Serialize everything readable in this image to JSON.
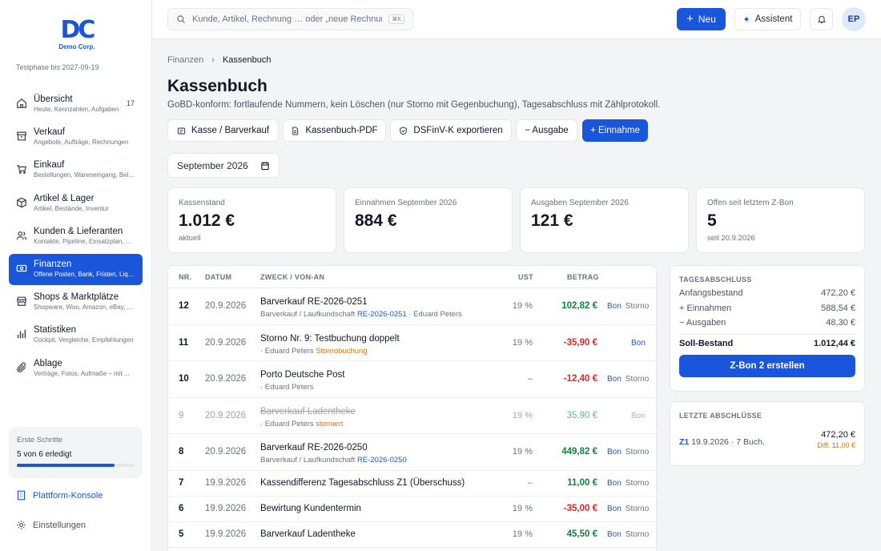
{
  "brand": {
    "logo_mark": "DC",
    "logo_text": "Demo Corp.",
    "trial": "Testphase bis 2027-09-19"
  },
  "nav": [
    {
      "title": "Übersicht",
      "sub": "Heute, Kennzahlen, Aufgaben",
      "count": "17",
      "icon": "home-icon"
    },
    {
      "title": "Verkauf",
      "sub": "Angebote, Aufträge, Rechnungen",
      "icon": "archive-box-icon"
    },
    {
      "title": "Einkauf",
      "sub": "Bestellungen, Wareneingang, Belege",
      "icon": "cart-icon"
    },
    {
      "title": "Artikel & Lager",
      "sub": "Artikel, Bestände, Inventur",
      "icon": "cube-icon"
    },
    {
      "title": "Kunden & Lieferanten",
      "sub": "Kontakte, Pipeline, Einsatzplan, ...",
      "icon": "users-icon"
    },
    {
      "title": "Finanzen",
      "sub": "Offene Posten, Bank, Fristen, Liquidität",
      "icon": "banknote-icon",
      "active": true
    },
    {
      "title": "Shops & Marktplätze",
      "sub": "Shopware, Woo, Amazon, eBay, ...",
      "icon": "shop-icon"
    },
    {
      "title": "Statistiken",
      "sub": "Cockpit, Vergleiche, Empfehlungen",
      "icon": "bar-chart-icon"
    },
    {
      "title": "Ablage",
      "sub": "Verträge, Fotos, Aufmaße – mit ...",
      "icon": "paperclip-icon"
    }
  ],
  "onboarding": {
    "label": "Erste Schritte",
    "value": "5 von 6 erledigt",
    "progress": 0.833
  },
  "footer": {
    "platform": "Plattform-Konsole",
    "settings": "Einstellungen"
  },
  "topbar": {
    "search_placeholder": "Kunde, Artikel, Rechnung … oder „neue Rechnung“",
    "shortcut": "⌘K",
    "new_label": "Neu",
    "assistant_label": "Assistent",
    "avatar": "EP"
  },
  "breadcrumb": {
    "parent": "Finanzen",
    "separator": "›",
    "current": "Kassenbuch"
  },
  "page": {
    "title": "Kassenbuch",
    "subtitle": "GoBD-konform: fortlaufende Nummern, kein Löschen (nur Storno mit Gegenbuchung), Tagesabschluss mit Zählprotokoll."
  },
  "actions": {
    "kasse": "Kasse / Barverkauf",
    "pdf": "Kassenbuch-PDF",
    "dsfinvk": "DSFinV-K exportieren",
    "ausgabe": "− Ausgabe",
    "einnahme": "+ Einnahme"
  },
  "period": "September 2026",
  "kpis": [
    {
      "label": "Kassenstand",
      "value": "1.012 €",
      "sub": "aktuell"
    },
    {
      "label": "Einnahmen September 2026",
      "value": "884 €",
      "sub": ""
    },
    {
      "label": "Ausgaben September 2026",
      "value": "121 €",
      "sub": ""
    },
    {
      "label": "Offen seit letztem Z-Bon",
      "value": "5",
      "sub": "seit 20.9.2026"
    }
  ],
  "table": {
    "headers": {
      "nr": "NR.",
      "datum": "DATUM",
      "zweck": "ZWECK / VON-AN",
      "ust": "UST",
      "betrag": "BETRAG"
    },
    "bon": "Bon",
    "storno": "Storno",
    "rows": [
      {
        "nr": "12",
        "datum": "20.9.2026",
        "zweck": "Barverkauf RE-2026-0251",
        "sub_a": "Barverkauf / Laufkundschaft",
        "sub_link": "RE-2026-0251",
        "sub_b": "· Eduard Peters",
        "sub_tag": "",
        "ust": "19 %",
        "betrag": "102,82 €",
        "sign": "pos",
        "storno": true
      },
      {
        "nr": "11",
        "datum": "20.9.2026",
        "zweck": "Storno Nr. 9: Testbuchung doppelt",
        "sub_a": "",
        "sub_link": "",
        "sub_b": "· Eduard Peters",
        "sub_tag": "Stornobuchung",
        "ust": "19 %",
        "betrag": "-35,90 €",
        "sign": "neg",
        "storno": false
      },
      {
        "nr": "10",
        "datum": "20.9.2026",
        "zweck": "Porto Deutsche Post",
        "sub_a": "",
        "sub_link": "",
        "sub_b": "· Eduard Peters",
        "sub_tag": "",
        "ust": "–",
        "betrag": "-12,40 €",
        "sign": "neg",
        "storno": true
      },
      {
        "nr": "9",
        "datum": "20.9.2026",
        "zweck": "Barverkauf Ladentheke",
        "sub_a": "",
        "sub_link": "",
        "sub_b": "· Eduard Peters",
        "sub_tag": "storniert",
        "ust": "19 %",
        "betrag": "35,90 €",
        "sign": "pos",
        "storno": false,
        "muted": true
      },
      {
        "nr": "8",
        "datum": "20.9.2026",
        "zweck": "Barverkauf RE-2026-0250",
        "sub_a": "Barverkauf / Laufkundschaft",
        "sub_link": "RE-2026-0250",
        "sub_b": "",
        "sub_tag": "",
        "ust": "19 %",
        "betrag": "449,82 €",
        "sign": "pos",
        "storno": true
      },
      {
        "nr": "7",
        "datum": "19.9.2026",
        "zweck": "Kassendifferenz Tagesabschluss Z1 (Überschuss)",
        "sub_a": "",
        "sub_link": "",
        "sub_b": "",
        "sub_tag": "",
        "ust": "–",
        "betrag": "11,00 €",
        "sign": "pos",
        "storno": true
      },
      {
        "nr": "6",
        "datum": "19.9.2026",
        "zweck": "Bewirtung Kundentermin",
        "sub_a": "",
        "sub_link": "",
        "sub_b": "",
        "sub_tag": "",
        "ust": "19 %",
        "betrag": "-35,00 €",
        "sign": "neg",
        "storno": true
      },
      {
        "nr": "5",
        "datum": "19.9.2026",
        "zweck": "Barverkauf Ladentheke",
        "sub_a": "",
        "sub_link": "",
        "sub_b": "",
        "sub_tag": "",
        "ust": "19 %",
        "betrag": "45,50 €",
        "sign": "pos",
        "storno": true
      }
    ]
  },
  "tagesabschluss": {
    "title": "TAGESABSCHLUSS",
    "rows": [
      {
        "label": "Anfangsbestand",
        "value": "472,20 €"
      },
      {
        "label": "+ Einnahmen",
        "value": "588,54 €"
      },
      {
        "label": "− Ausgaben",
        "value": "48,30 €"
      }
    ],
    "total_label": "Soll-Bestand",
    "total_value": "1.012,44 €",
    "button": "Z-Bon 2 erstellen"
  },
  "abschluesse": {
    "title": "LETZTE ABSCHLÜSSE",
    "items": [
      {
        "z": "Z1",
        "text": "19.9.2026 · 7 Buch.",
        "amount": "472,20 €",
        "diff": "Diff. 11,00 €"
      }
    ]
  },
  "colors": {
    "primary": "#1a56db",
    "positive": "#15803d",
    "negative": "#dc2626",
    "warning": "#d9730d"
  }
}
